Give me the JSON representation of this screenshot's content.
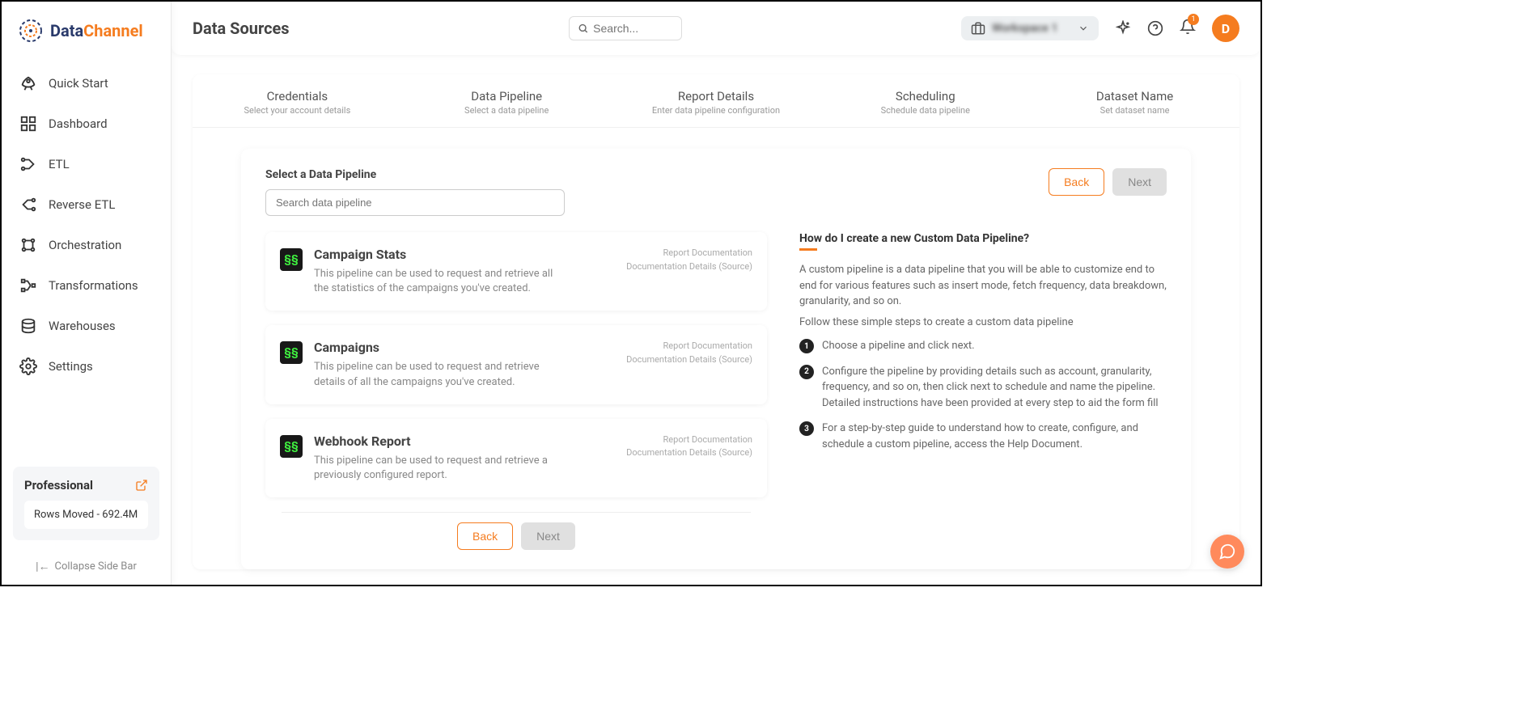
{
  "brand": {
    "part1": "Data",
    "part2": "Channel"
  },
  "page_title": "Data Sources",
  "search": {
    "placeholder": "Search..."
  },
  "workspace": {
    "label": "Workspace 1"
  },
  "notifications": {
    "count": "1"
  },
  "avatar": {
    "initial": "D"
  },
  "nav": [
    {
      "label": "Quick Start"
    },
    {
      "label": "Dashboard"
    },
    {
      "label": "ETL"
    },
    {
      "label": "Reverse ETL"
    },
    {
      "label": "Orchestration"
    },
    {
      "label": "Transformations"
    },
    {
      "label": "Warehouses"
    },
    {
      "label": "Settings"
    }
  ],
  "plan": {
    "name": "Professional",
    "rows": "Rows Moved - 692.4M"
  },
  "collapse": "Collapse Side Bar",
  "steps": [
    {
      "title": "Credentials",
      "sub": "Select your account details"
    },
    {
      "title": "Data Pipeline",
      "sub": "Select a data pipeline"
    },
    {
      "title": "Report Details",
      "sub": "Enter data pipeline configuration"
    },
    {
      "title": "Scheduling",
      "sub": "Schedule data pipeline"
    },
    {
      "title": "Dataset Name",
      "sub": "Set dataset name"
    }
  ],
  "section": {
    "label": "Select a Data Pipeline",
    "search_placeholder": "Search data pipeline"
  },
  "buttons": {
    "back": "Back",
    "next": "Next"
  },
  "pipelines": [
    {
      "name": "Campaign Stats",
      "desc": "This pipeline can be used to request and retrieve all the statistics of the campaigns you've created.",
      "doc1": "Report Documentation",
      "doc2": "Documentation Details (Source)"
    },
    {
      "name": "Campaigns",
      "desc": "This pipeline can be used to request and retrieve details of all the campaigns you've created.",
      "doc1": "Report Documentation",
      "doc2": "Documentation Details (Source)"
    },
    {
      "name": "Webhook Report",
      "desc": "This pipeline can be used to request and retrieve a previously configured report.",
      "doc1": "Report Documentation",
      "doc2": "Documentation Details (Source)"
    }
  ],
  "help": {
    "title": "How do I create a new Custom Data Pipeline?",
    "p1": "A custom pipeline is a data pipeline that you will be able to customize end to end for various features such as insert mode, fetch frequency, data breakdown, granularity, and so on.",
    "p2": "Follow these simple steps to create a custom data pipeline",
    "steps": [
      "Choose a pipeline and click next.",
      "Configure the pipeline by providing details such as account, granularity, frequency, and so on, then click next to schedule and name the pipeline. Detailed instructions have been provided at every step to aid the form fill",
      "For a step-by-step guide to understand how to create, configure, and schedule a custom pipeline, access the Help Document."
    ]
  }
}
